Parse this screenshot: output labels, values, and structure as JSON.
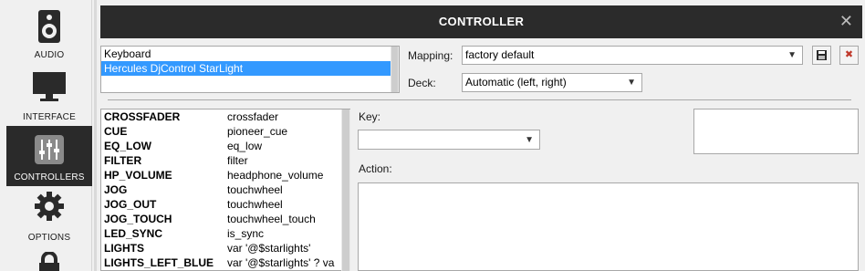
{
  "sidebar": {
    "items": [
      {
        "label": "AUDIO",
        "icon": "speaker-icon",
        "active": false
      },
      {
        "label": "INTERFACE",
        "icon": "monitor-icon",
        "active": false
      },
      {
        "label": "CONTROLLERS",
        "icon": "sliders-icon",
        "active": true
      },
      {
        "label": "OPTIONS",
        "icon": "gear-icon",
        "active": false
      },
      {
        "label": "",
        "icon": "lock-icon",
        "active": false
      }
    ]
  },
  "dialog": {
    "title": "CONTROLLER",
    "close_symbol": "✕"
  },
  "devices": [
    "Keyboard",
    "Hercules DjControl StarLight"
  ],
  "selected_device": "Hercules DjControl StarLight",
  "mapping": {
    "label": "Mapping:",
    "value": "factory default",
    "save_symbol": "💾",
    "delete_symbol": "✖"
  },
  "deck": {
    "label": "Deck:",
    "value": "Automatic (left, right)"
  },
  "key": {
    "label": "Key:",
    "value": ""
  },
  "action": {
    "label": "Action:",
    "value": ""
  },
  "bindings": [
    {
      "key": "CROSSFADER",
      "action": "crossfader"
    },
    {
      "key": "CUE",
      "action": "pioneer_cue"
    },
    {
      "key": "EQ_LOW",
      "action": "eq_low"
    },
    {
      "key": "FILTER",
      "action": "filter"
    },
    {
      "key": "HP_VOLUME",
      "action": "headphone_volume"
    },
    {
      "key": "JOG",
      "action": "touchwheel"
    },
    {
      "key": "JOG_OUT",
      "action": "touchwheel"
    },
    {
      "key": "JOG_TOUCH",
      "action": "touchwheel_touch"
    },
    {
      "key": "LED_SYNC",
      "action": "is_sync"
    },
    {
      "key": "LIGHTS",
      "action": "var '@$starlights'"
    },
    {
      "key": "LIGHTS_LEFT_BLUE",
      "action": "var '@$starlights' ? va"
    }
  ],
  "colors": {
    "titlebar": "#2b2b2b",
    "selection": "#3399ff",
    "sidebar_active": "#2a2a2a"
  }
}
